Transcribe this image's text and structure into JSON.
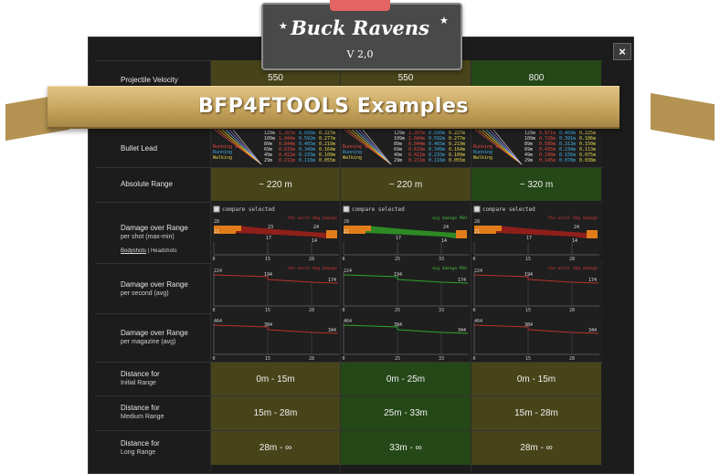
{
  "app": {
    "title": "Buck Ravens",
    "version": "V 2,0",
    "banner": "BFP4FTOOLS Examples",
    "close": "×"
  },
  "rows": {
    "velocity": {
      "label": "Projectile Velocity",
      "values": [
        "550",
        "550",
        "800"
      ]
    },
    "lead": {
      "label": "Bullet Lead"
    },
    "range": {
      "label": "Absolute Range",
      "values": [
        "~ 220 m",
        "~ 220 m",
        "~ 320 m"
      ]
    },
    "dmg_shot": {
      "label": "Damage over Range",
      "sub": "per shot (max-min)",
      "body": "Bodyshots",
      "sep": " | ",
      "head": "Headshots"
    },
    "dmg_sec": {
      "label": "Damage over Range",
      "sub": "per second (avg)"
    },
    "dmg_mag": {
      "label": "Damage over Range",
      "sub": "per magazine (avg)"
    },
    "initial": {
      "label": "Distance for",
      "sub": "Initial Range",
      "values": [
        "0m - 15m",
        "0m - 25m",
        "0m - 15m"
      ]
    },
    "medium": {
      "label": "Distance for",
      "sub": "Medium Range",
      "values": [
        "15m - 28m",
        "25m - 33m",
        "15m - 28m"
      ]
    },
    "long": {
      "label": "Distance for",
      "sub": "Long Range",
      "values": [
        "28m - ∞",
        "33m - ∞",
        "28m - ∞"
      ]
    }
  },
  "compare": "compare selected",
  "lead_legend": {
    "lines": [
      "Running x2",
      "Running",
      "Walking"
    ],
    "cols": [
      {
        "dist": [
          "129m",
          "109m",
          "89m",
          "69m",
          "49m",
          "29m"
        ],
        "a": [
          "1.267m",
          "1.044m",
          "0.844m",
          "0.633m",
          "0.422m",
          "0.211m"
        ],
        "b": [
          "0.690m",
          "0.592m",
          "0.465m",
          "0.349m",
          "0.233m",
          "0.116m"
        ],
        "c": [
          "0.227m",
          "0.277m",
          "0.219m",
          "0.164m",
          "0.109m",
          "0.055m"
        ]
      },
      {
        "dist": [
          "129m",
          "109m",
          "89m",
          "69m",
          "49m",
          "29m"
        ],
        "a": [
          "1.267m",
          "1.044m",
          "0.844m",
          "0.633m",
          "0.422m",
          "0.211m"
        ],
        "b": [
          "0.690m",
          "0.592m",
          "0.465m",
          "0.349m",
          "0.233m",
          "0.116m"
        ],
        "c": [
          "0.227m",
          "0.277m",
          "0.219m",
          "0.164m",
          "0.109m",
          "0.055m"
        ]
      },
      {
        "dist": [
          "129m",
          "109m",
          "89m",
          "69m",
          "49m",
          "29m"
        ],
        "a": [
          "0.871m",
          "0.726m",
          "0.580m",
          "0.435m",
          "0.290m",
          "0.145m"
        ],
        "b": [
          "0.469m",
          "0.391m",
          "0.313m",
          "0.234m",
          "0.156m",
          "0.078m"
        ],
        "c": [
          "0.225m",
          "0.186m",
          "0.150m",
          "0.113m",
          "0.075m",
          "0.038m"
        ]
      }
    ]
  },
  "charts": {
    "shot": [
      {
        "note": "the worst dmg damage",
        "top": "28",
        "vals": [
          "21",
          "23",
          "24"
        ],
        "min": "17",
        "min2": "14",
        "x": [
          "0",
          "15",
          "28"
        ]
      },
      {
        "note": "avg damage MSH",
        "top": "28",
        "vals": [
          "21",
          "",
          "24"
        ],
        "min": "17",
        "min2": "14",
        "x": [
          "0",
          "25",
          "33"
        ]
      },
      {
        "note": "the worst dmg damage",
        "top": "28",
        "vals": [
          "21",
          "",
          "24"
        ],
        "min": "17",
        "min2": "14",
        "x": [
          "0",
          "15",
          "28"
        ]
      }
    ],
    "sec": [
      {
        "note": "the worst dmg damage",
        "top": "224",
        "mid": "194",
        "end": "174",
        "x": [
          "0",
          "15",
          "28"
        ],
        "color": "#b9322b"
      },
      {
        "note": "avg damage MSH",
        "top": "224",
        "mid": "194",
        "end": "174",
        "x": [
          "0",
          "25",
          "33"
        ],
        "color": "#2fa52a"
      },
      {
        "note": "the worst dmg damage",
        "top": "224",
        "mid": "194",
        "end": "174",
        "x": [
          "0",
          "15",
          "28"
        ],
        "color": "#b9322b"
      }
    ],
    "mag": [
      {
        "top": "464",
        "mid": "384",
        "end": "344",
        "x": [
          "0",
          "15",
          "28"
        ],
        "color": "#b9322b"
      },
      {
        "top": "464",
        "mid": "384",
        "end": "344",
        "x": [
          "0",
          "25",
          "33"
        ],
        "color": "#2fa52a"
      },
      {
        "top": "464",
        "mid": "384",
        "end": "344",
        "x": [
          "0",
          "15",
          "28"
        ],
        "color": "#b9322b"
      }
    ]
  },
  "colors": {
    "yellow": "#47441a",
    "green": "#254818",
    "red": "#b9322b",
    "greenline": "#2fa52a",
    "orange": "#e07d1a",
    "banner": "#c6a45c",
    "ribbon": "#e36462"
  }
}
